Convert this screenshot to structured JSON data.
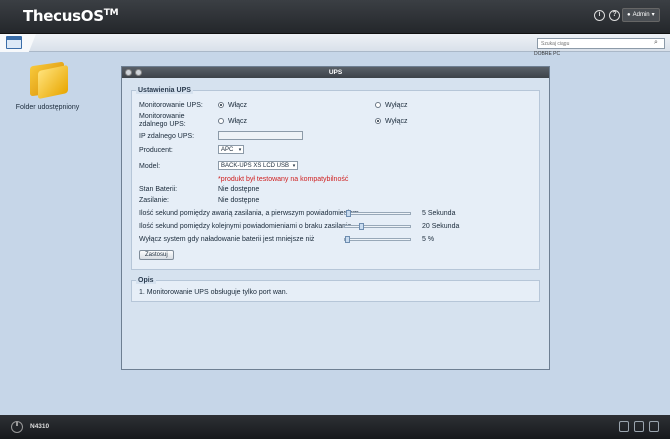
{
  "app": {
    "logo_text": "ThecusOS",
    "logo_sup": "TM",
    "user_label": "Admin"
  },
  "top_icons": {
    "info": "i",
    "help": "?"
  },
  "search": {
    "placeholder": "Szukaj ciągu"
  },
  "brand_text": "DOBRE PC",
  "desktop": {
    "folder_label": "Folder udostępniony"
  },
  "window": {
    "title": "UPS",
    "settings_legend": "Ustawienia UPS",
    "monitor_label": "Monitorowanie UPS:",
    "monitor_on": "Włącz",
    "monitor_off": "Wyłącz",
    "remote_label": "Monitorowanie zdalnego UPS:",
    "remote_on": "Włącz",
    "remote_off": "Wyłącz",
    "remote_ip_label": "IP zdalnego UPS:",
    "remote_ip_value": "",
    "vendor_label": "Producent:",
    "vendor_value": "APC",
    "model_label": "Model:",
    "model_value": "BACK-UPS XS LCD USB",
    "compat_note": "*produkt był testowany na kompatybilność",
    "battery_label": "Stan Baterii:",
    "battery_value": "Nie dostępne",
    "power_label": "Zasilanie:",
    "power_value": "Nie dostępne",
    "slider1_label": "Ilość sekund pomiędzy awarią zasilania, a pierwszym powiadomieniem",
    "slider1_value": "5 Sekunda",
    "slider1_fraction": 0.02,
    "slider2_label": "Ilość sekund pomiędzy kolejnymi powiadomieniami o braku zasilania",
    "slider2_value": "20 Sekunda",
    "slider2_fraction": 0.24,
    "slider3_label": "Wyłącz system gdy naładowanie baterii jest mniejsze niż",
    "slider3_value": "5 %",
    "slider3_fraction": 0.0,
    "apply_button": "Zastosuj",
    "desc_legend": "Opis",
    "desc_text": "1. Monitorowanie UPS obsługuje tylko port wan."
  },
  "taskbar": {
    "model_name": "N4310"
  }
}
